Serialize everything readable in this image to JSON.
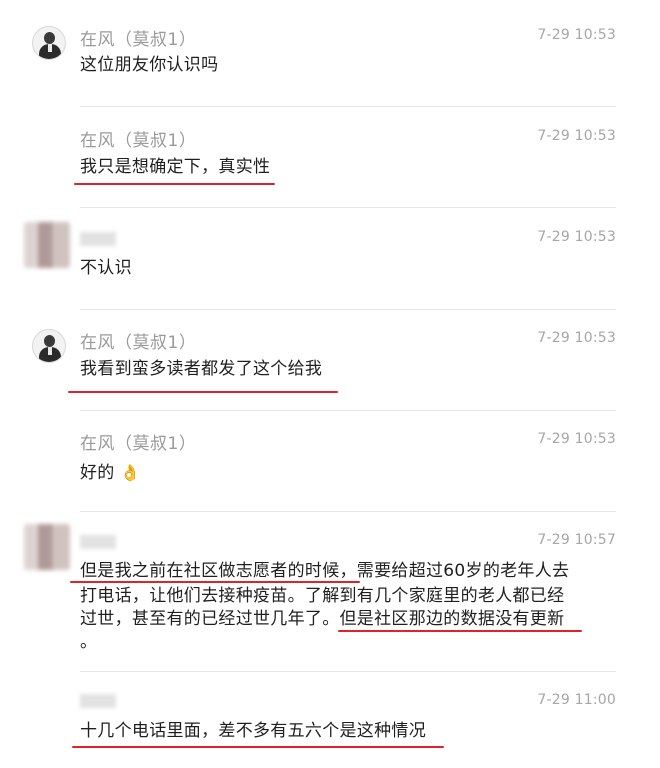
{
  "messages": [
    {
      "name": "在风（莫叔1）",
      "time": "7-29 10:53",
      "text": "这位朋友你认识吗"
    },
    {
      "name": "在风（莫叔1）",
      "time": "7-29 10:53",
      "text": "我只是想确定下，真实性"
    },
    {
      "name": "",
      "time": "7-29 10:53",
      "text": "不认识"
    },
    {
      "name": "在风（莫叔1）",
      "time": "7-29 10:53",
      "text": "我看到蛮多读者都发了这个给我"
    },
    {
      "name": "在风（莫叔1）",
      "time": "7-29 10:53",
      "text": "好的",
      "emoji": "👌"
    },
    {
      "name": "",
      "time": "7-29 10:57",
      "lines": [
        "但是我之前在社区做志愿者的时候，需要给超过60岁的老年人去",
        "打电话，让他们去接种疫苗。了解到有几个家庭里的老人都已经",
        "过世，甚至有的已经过世几年了。但是社区那边的数据没有更新",
        "。"
      ]
    },
    {
      "name": "",
      "time": "7-29 11:00",
      "text": "十几个电话里面，差不多有五六个是这种情况"
    }
  ],
  "colors": {
    "underline": "#e0222a",
    "name": "#9a9a9a",
    "time": "#a6a6a6",
    "text": "#1f1f1f"
  }
}
